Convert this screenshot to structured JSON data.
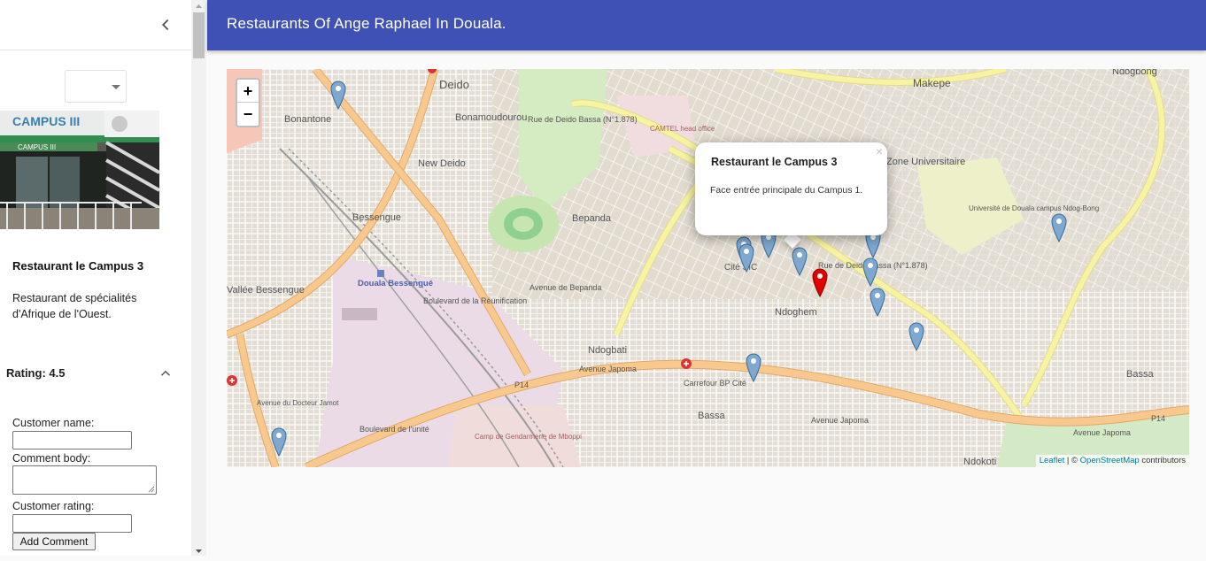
{
  "app": {
    "title": "Restaurants Of Ange Raphael In Douala."
  },
  "restaurant": {
    "name": "Restaurant le Campus 3",
    "description": "Restaurant de spécialités d'Afrique de l'Ouest.",
    "photo_sign": "CAMPUS III",
    "photo_sign_small": "CAMPUS III"
  },
  "rating": {
    "label": "Rating: 4.5"
  },
  "form": {
    "customer_name_label": "Customer name:",
    "comment_body_label": "Comment body:",
    "customer_rating_label": "Customer rating:",
    "add_button": "Add Comment"
  },
  "popup": {
    "title": "Restaurant le Campus 3",
    "description": "Face entrée principale du Campus 1.",
    "close": "×"
  },
  "map": {
    "zoom_in": "+",
    "zoom_out": "−",
    "attribution_leaflet": "Leaflet",
    "attribution_sep": " | © ",
    "attribution_osm": "OpenStreetMap",
    "attribution_tail": " contributors",
    "labels": {
      "deido": "Deido",
      "makepe": "Makepe",
      "ndogbong": "Ndogbong",
      "bonantone": "Bonantone",
      "bonamoudourou": "Bonamoudourou",
      "new_deido": "New Deido",
      "bessengue": "Bessengue",
      "bepanda": "Bepanda",
      "vallee_bessengue": "Vallée Bessengue",
      "douala_bessengue": "Douala Bessengué",
      "ndoghem": "Ndoghem",
      "ndogbati": "Ndogbati",
      "carrefour": "Carrefour BP Cité",
      "bassa": "Bassa",
      "bassa_east": "Bassa",
      "ndokoti": "Ndokoti",
      "campus": "Université de Douala campus Ndog-Bong",
      "cite": "Cité SIC",
      "camtel": "CAMTEL head office",
      "camp_gendarmerie": "Camp de Gendarmerie de Mboppi",
      "zone_universitaire": "Zone Universitaire",
      "ave_japoma": "Avenue Japoma",
      "ave_japoma_2": "Avenue Japoma",
      "ave_japoma_3": "Avenue Japoma",
      "blvd_unite": "Boulevard de l'unité",
      "blvd_reunification": "Boulevard de la Réunification",
      "rue_deido_bassa": "Rue de Deido Bassa (N°1.878)",
      "rue_deido_bassa_2": "Rue de Deido Bassa (N°1.878)",
      "ave_bepanda": "Avenue de Bepanda",
      "p14": "P14",
      "p14_east": "P14",
      "ave_docteur": "Avenue du Docteur Jamot",
      "cite_sic": "Cité SIC"
    }
  },
  "colors": {
    "appbar": "#3f51b5",
    "marker_blue": "#7fa8d1",
    "marker_red": "#e00000",
    "road_main": "#f8c98e",
    "road_secondary": "#f4f1a0"
  }
}
